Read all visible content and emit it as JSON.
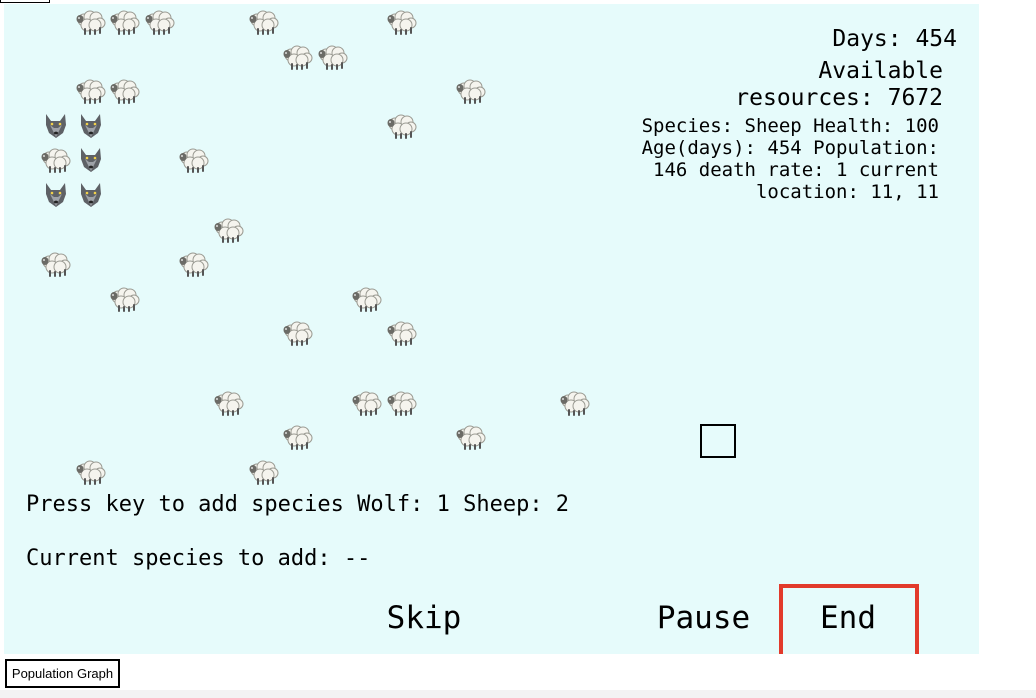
{
  "hud": {
    "days_label": "Days: 454",
    "resources_line1": "Available",
    "resources_line2": "resources: 7672",
    "info_line1": "Species: Sheep Health: 100",
    "info_line2": "Age(days): 454 Population:",
    "info_line3": "146 death rate: 1 current",
    "info_line4": "location: 11, 11"
  },
  "instructions": {
    "add_species": "Press key to add species Wolf: 1 Sheep: 2",
    "current_species": "Current species to add: --"
  },
  "controls": {
    "skip_label": "Skip",
    "pause_label": "Pause",
    "end_label": "End"
  },
  "footer": {
    "graph_button_label": "Population Graph"
  },
  "colors": {
    "board_background": "#e6fbfb",
    "highlight": "#e23a2b"
  },
  "icons": {
    "sheep": "sheep-icon",
    "wolf": "wolf-icon"
  }
}
